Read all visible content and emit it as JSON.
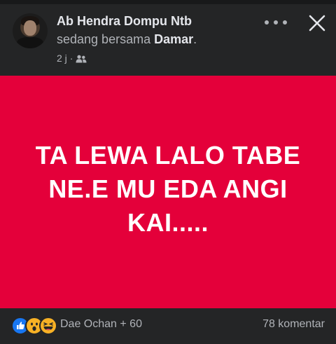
{
  "header": {
    "author": "Ab Hendra Dompu Ntb",
    "with_prefix": "sedang bersama ",
    "with_name": "Damar",
    "with_suffix": ".",
    "time": "2 j",
    "separator": "·",
    "privacy_icon": "friends-icon",
    "more_icon": "more-dots-icon",
    "close_icon": "close-icon"
  },
  "post": {
    "text": "TA LEWA LALO TABE\nNE.E MU EDA  ANGI\nKAI.....",
    "background": "#e4003a",
    "text_color": "#ffffff"
  },
  "footer": {
    "reactions": [
      "like-reaction-icon",
      "wow-reaction-icon",
      "haha-reaction-icon"
    ],
    "reactors": "Dae Ochan + 60",
    "comments": "78 komentar"
  },
  "colors": {
    "page_bg": "#242526",
    "text_primary": "#e4e6eb",
    "text_secondary": "#b0b3b8",
    "like_blue": "#1877f2",
    "emoji_yellow": "#f7b125"
  }
}
